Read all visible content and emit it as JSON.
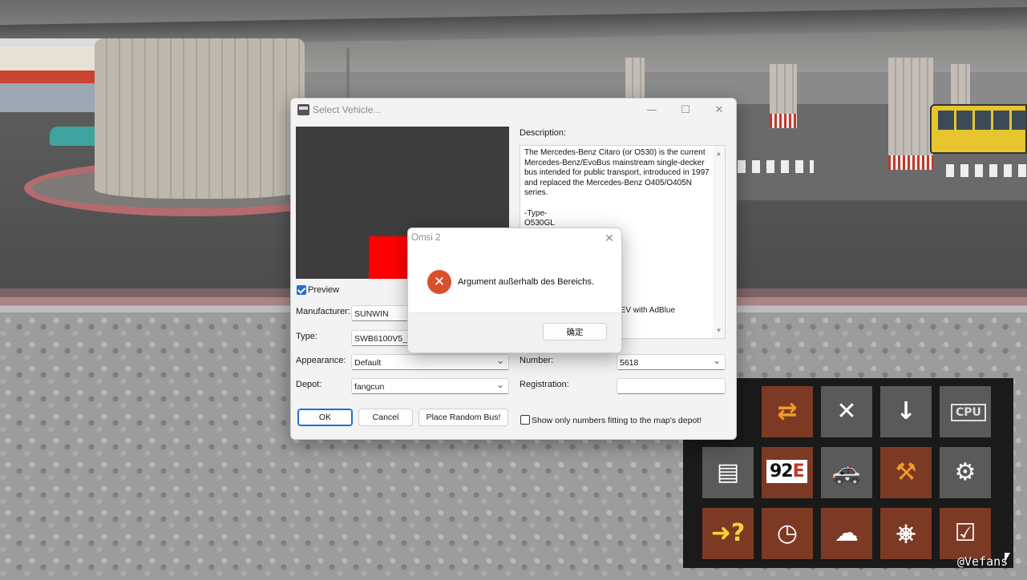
{
  "select_vehicle": {
    "title": "Select Vehicle...",
    "description_label": "Description:",
    "description_text": "The Mercedes-Benz Citaro (or O530) is the current Mercedes-Benz/EvoBus mainstream single-decker bus intended for public transport, introduced in 1997 and replaced the Mercedes-Benz O405/O405N series.\n\n-Type-\nO530GL",
    "description_visible_fragment": "EEV with AdBlue",
    "preview_label": "Preview",
    "preview_checked": true,
    "manufacturer_label": "Manufacturer:",
    "manufacturer_value": "SUNWIN",
    "type_label": "Type:",
    "type_value": "SWB6100V5_6A",
    "appearance_label": "Appearance:",
    "appearance_value": "Default",
    "depot_label": "Depot:",
    "depot_value": "fangcun",
    "number_label": "Number:",
    "number_value": "5618",
    "registration_label": "Registration:",
    "registration_value": "",
    "ok_label": "OK",
    "cancel_label": "Cancel",
    "random_label": "Place Random Bus!",
    "show_only_label": "Show only numbers fitting to the map's depot!",
    "show_only_checked": false
  },
  "error_dialog": {
    "title": "Omsi 2",
    "message": "Argument außerhalb des Bereichs.",
    "confirm_label": "确定"
  },
  "game_menu": {
    "tiles": [
      {
        "icon": "bus-rear-icon"
      },
      {
        "icon": "swap-bus-icon"
      },
      {
        "icon": "remove-bus-icon"
      },
      {
        "icon": "despawn-bus-icon"
      },
      {
        "icon": "cpu-bus-icon"
      },
      {
        "icon": "ticket-printer-icon"
      },
      {
        "icon": "route-number-icon",
        "text_a": "92",
        "text_b": "E"
      },
      {
        "icon": "police-car-icon"
      },
      {
        "icon": "repair-tools-icon"
      },
      {
        "icon": "ticket-machine-icon"
      },
      {
        "icon": "help-arrow-icon"
      },
      {
        "icon": "clock-icon"
      },
      {
        "icon": "weather-icon"
      },
      {
        "icon": "driver-cab-icon"
      },
      {
        "icon": "timetable-person-icon"
      }
    ]
  },
  "watermark": "@Vefans"
}
